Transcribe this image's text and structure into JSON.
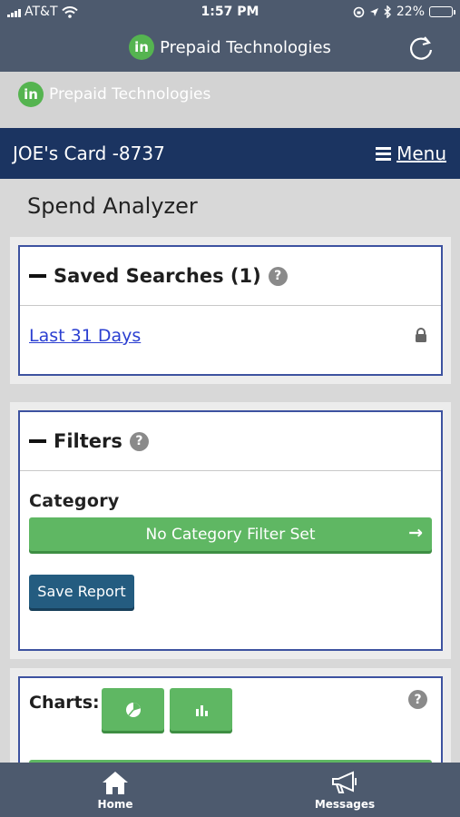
{
  "status_bar": {
    "carrier": "AT&T",
    "time": "1:57 PM",
    "battery": "22%",
    "battery_level": 0.22
  },
  "app_bar": {
    "brand_mark": "in",
    "brand_name": "Prepaid Technologies"
  },
  "brand_strip": {
    "brand_mark": "in",
    "brand_name": "Prepaid Technologies"
  },
  "card_bar": {
    "card_title": "JOE's Card -8737",
    "menu_label": "Menu"
  },
  "page": {
    "title": "Spend Analyzer"
  },
  "saved_searches": {
    "title": "Saved Searches (1)",
    "help": "?",
    "items": [
      {
        "label": "Last 31 Days"
      }
    ]
  },
  "filters": {
    "title": "Filters",
    "help": "?",
    "category_label": "Category",
    "category_button": "No Category Filter Set",
    "category_arrow": "→",
    "save_report": "Save Report"
  },
  "charts": {
    "title": "Charts:",
    "help": "?"
  },
  "tab_bar": {
    "home_label": "Home",
    "messages_label": "Messages"
  },
  "colors": {
    "header": "#4d5a6e",
    "card_bar": "#1b3461",
    "green": "#5fb763",
    "save": "#245c80",
    "link": "#2b3fd1"
  }
}
